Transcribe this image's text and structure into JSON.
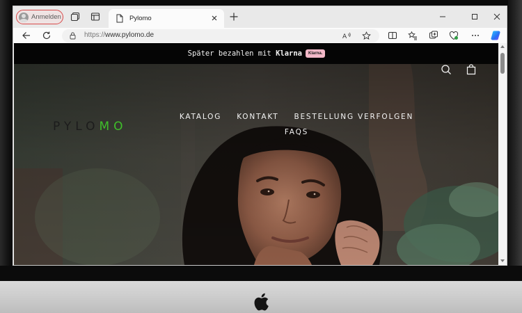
{
  "browser": {
    "profile_label": "Anmelden",
    "tab_title": "Pylomo",
    "url_prefix": "https://",
    "url_host": "www.pylomo.de"
  },
  "page": {
    "announcement_prefix": "Später bezahlen mit",
    "announcement_brand": "Klarna",
    "klarna_badge": "Klarna.",
    "logo_part1": "PYLO",
    "logo_part2": "MO",
    "nav": {
      "katalog": "KATALOG",
      "kontakt": "KONTAKT",
      "bestellung": "BESTELLUNG VERFOLGEN",
      "faqs": "FAQS"
    }
  },
  "colors": {
    "accent_green": "#3fbf2a",
    "profile_border": "#d84a4a",
    "klarna_pink": "#f3b8c8"
  },
  "icons": {
    "tabs": "tab-actions-icon",
    "vertical_tabs": "vertical-tabs-icon",
    "page": "page-icon",
    "search": "search-icon",
    "cart": "cart-icon"
  }
}
